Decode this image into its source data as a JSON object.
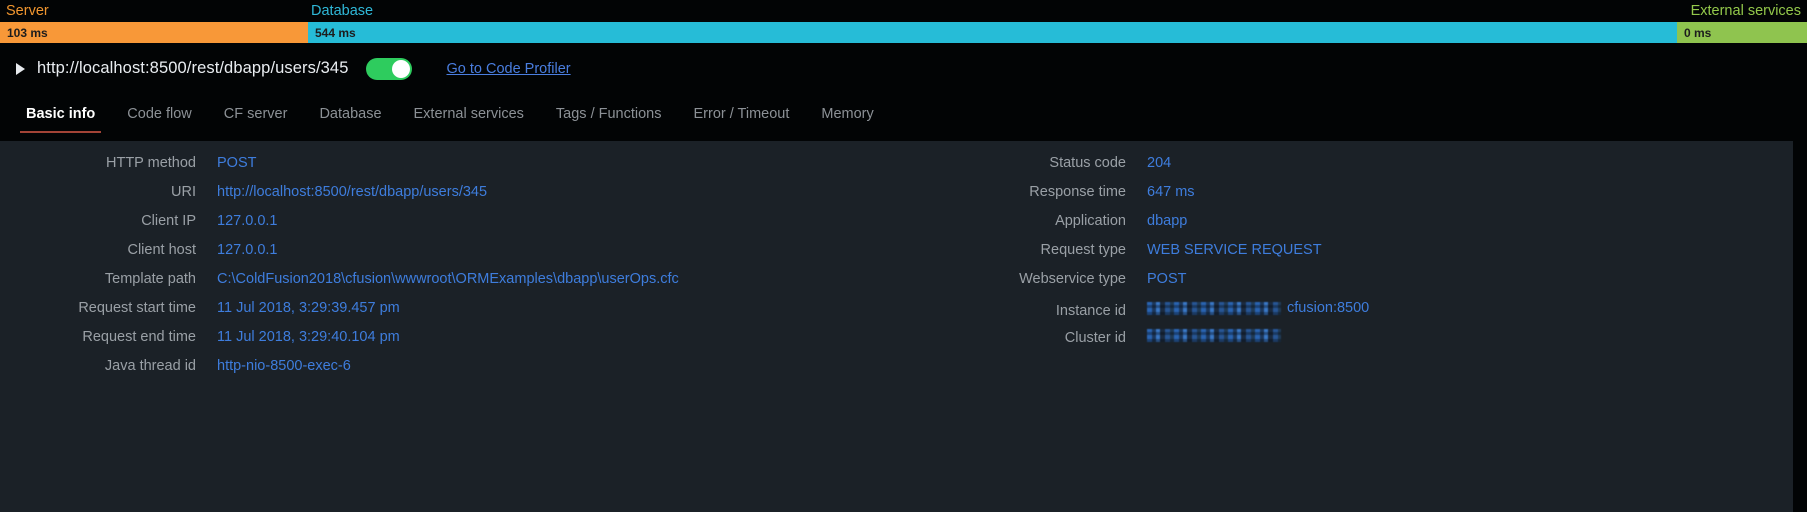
{
  "timeline": {
    "segments": [
      {
        "label": "Server",
        "value": "103 ms",
        "color": "#f89838"
      },
      {
        "label": "Database",
        "value": "544 ms",
        "color": "#26bcd7"
      },
      {
        "label": "External services",
        "value": "0 ms",
        "color": "#8fc44f"
      }
    ]
  },
  "request": {
    "url": "http://localhost:8500/rest/dbapp/users/345",
    "toggle_state": "on",
    "profiler_link": "Go to Code Profiler"
  },
  "tabs": [
    {
      "label": "Basic info",
      "active": true
    },
    {
      "label": "Code flow",
      "active": false
    },
    {
      "label": "CF server",
      "active": false
    },
    {
      "label": "Database",
      "active": false
    },
    {
      "label": "External services",
      "active": false
    },
    {
      "label": "Tags / Functions",
      "active": false
    },
    {
      "label": "Error / Timeout",
      "active": false
    },
    {
      "label": "Memory",
      "active": false
    }
  ],
  "details": {
    "left": [
      {
        "label": "HTTP method",
        "value": "POST"
      },
      {
        "label": "URI",
        "value": "http://localhost:8500/rest/dbapp/users/345"
      },
      {
        "label": "Client IP",
        "value": "127.0.0.1"
      },
      {
        "label": "Client host",
        "value": "127.0.0.1"
      },
      {
        "label": "Template path",
        "value": "C:\\ColdFusion2018\\cfusion\\wwwroot\\ORMExamples\\dbapp\\userOps.cfc"
      },
      {
        "label": "Request start time",
        "value": "11 Jul 2018, 3:29:39.457 pm"
      },
      {
        "label": "Request end time",
        "value": "11 Jul 2018, 3:29:40.104 pm"
      },
      {
        "label": "Java thread id",
        "value": "http-nio-8500-exec-6"
      }
    ],
    "right": [
      {
        "label": "Status code",
        "value": "204"
      },
      {
        "label": "Response time",
        "value": "647 ms"
      },
      {
        "label": "Application",
        "value": "dbapp"
      },
      {
        "label": "Request type",
        "value": "WEB SERVICE REQUEST"
      },
      {
        "label": "Webservice type",
        "value": "POST"
      },
      {
        "label": "Instance id",
        "value": "cfusion:8500",
        "redacted": true
      },
      {
        "label": "Cluster id",
        "value": "",
        "redacted": true
      }
    ]
  },
  "colors": {
    "page_background": "#020405",
    "panel_background": "#1b2127",
    "link": "#3e7ddd",
    "label": "#9aa0a6",
    "active_tab_underline": "#a34336",
    "toggle_on": "#2ecc5e"
  }
}
